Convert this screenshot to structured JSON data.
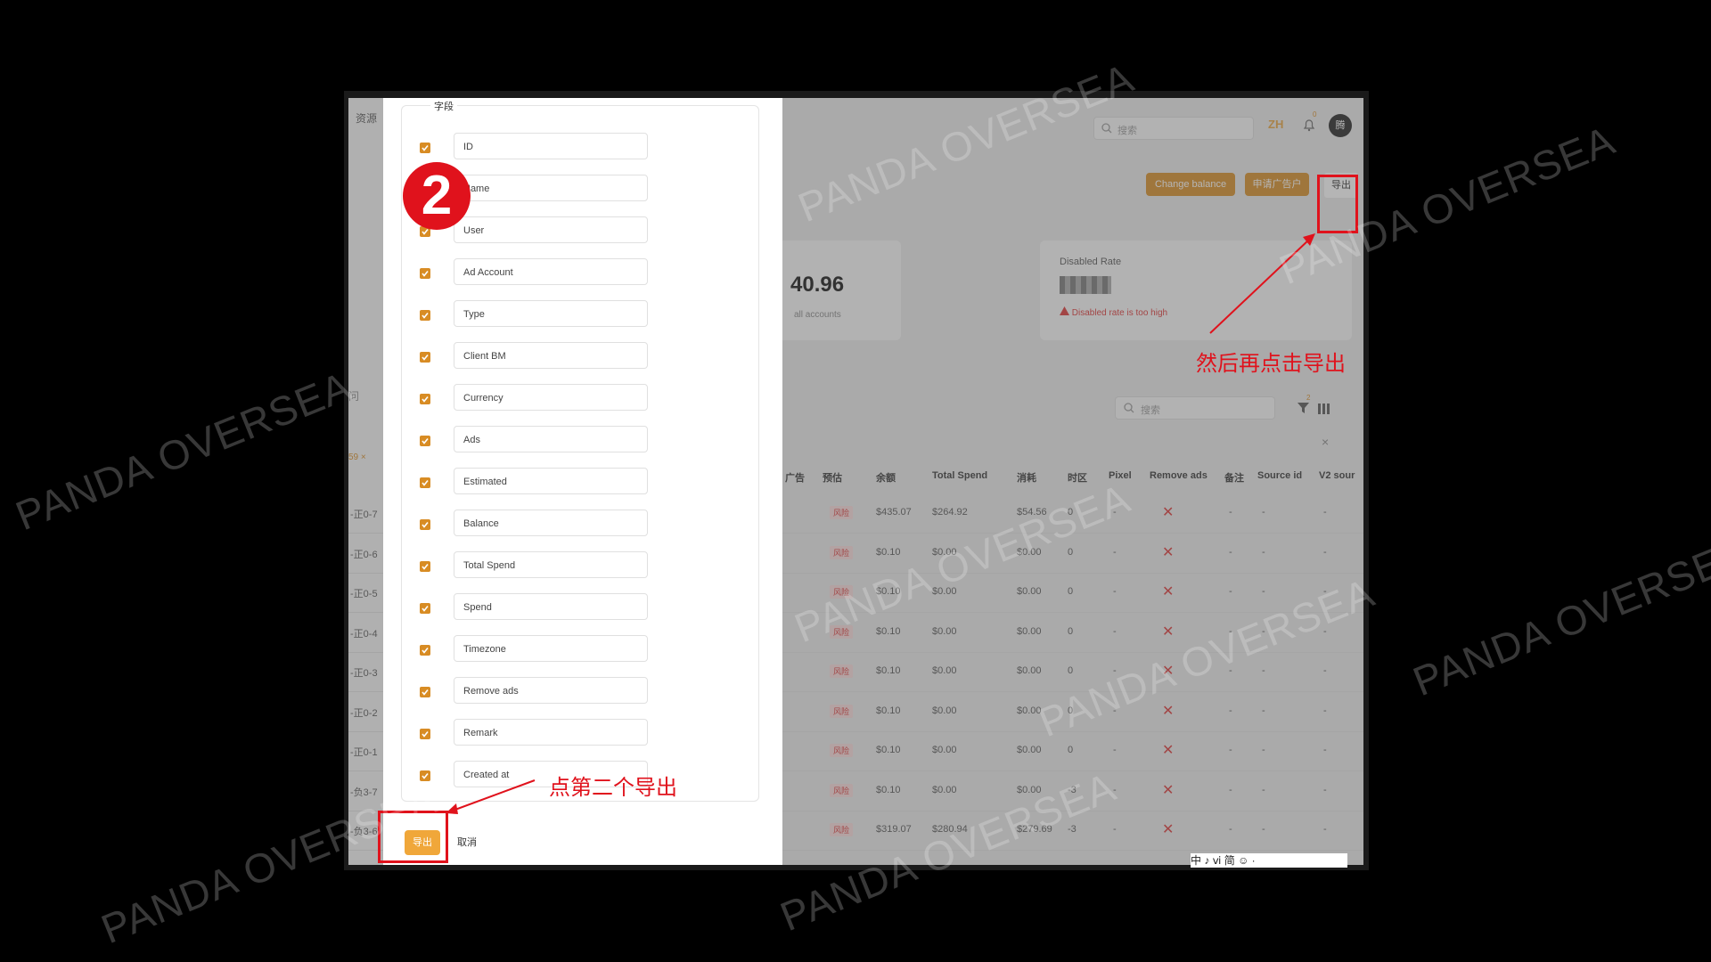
{
  "topbar": {
    "nav_left": "资源",
    "search_placeholder": "搜索",
    "lang": "ZH",
    "bell_count": "0",
    "avatar": "腾"
  },
  "actions": {
    "change_balance": "Change balance",
    "apply_account": "申请广告户",
    "export": "导出"
  },
  "stats": {
    "balance_value": "40.96",
    "balance_caption": "all accounts",
    "disabled_rate_title": "Disabled Rate",
    "disabled_rate_warning": "Disabled rate is too high"
  },
  "side_labels": [
    "问",
    "59 ×"
  ],
  "table": {
    "search_placeholder": "搜索",
    "filter_count": "2",
    "headers": [
      "广告",
      "预估",
      "余额",
      "Total Spend",
      "消耗",
      "时区",
      "Pixel",
      "Remove ads",
      "备注",
      "Source id",
      "V2 sour"
    ],
    "row_ids": [
      "-正0-7",
      "-正0-6",
      "-正0-5",
      "-正0-4",
      "-正0-3",
      "-正0-2",
      "-正0-1",
      "-负3-7",
      "-负3-6"
    ],
    "tag": "风险",
    "rows": [
      {
        "balance": "$435.07",
        "total": "$264.92",
        "spend": "$54.56",
        "tz": "0"
      },
      {
        "balance": "$0.10",
        "total": "$0.00",
        "spend": "$0.00",
        "tz": "0"
      },
      {
        "balance": "$0.10",
        "total": "$0.00",
        "spend": "$0.00",
        "tz": "0"
      },
      {
        "balance": "$0.10",
        "total": "$0.00",
        "spend": "$0.00",
        "tz": "0"
      },
      {
        "balance": "$0.10",
        "total": "$0.00",
        "spend": "$0.00",
        "tz": "0"
      },
      {
        "balance": "$0.10",
        "total": "$0.00",
        "spend": "$0.00",
        "tz": "0"
      },
      {
        "balance": "$0.10",
        "total": "$0.00",
        "spend": "$0.00",
        "tz": "0"
      },
      {
        "balance": "$0.10",
        "total": "$0.00",
        "spend": "$0.00",
        "tz": "-3"
      },
      {
        "balance": "$319.07",
        "total": "$280.94",
        "spend": "$279.69",
        "tz": "-3"
      }
    ],
    "dash": "-",
    "close": "×"
  },
  "panel": {
    "fields_title": "字段",
    "fields": [
      "ID",
      "Name",
      "User",
      "Ad Account",
      "Type",
      "Client BM",
      "Currency",
      "Ads",
      "Estimated",
      "Balance",
      "Total Spend",
      "Spend",
      "Timezone",
      "Remove ads",
      "Remark",
      "Created at"
    ],
    "export_label": "导出",
    "cancel_label": "取消"
  },
  "annotations": {
    "step_number": "2",
    "click_second_export": "点第二个导出",
    "then_click_export": "然后再点击导出"
  },
  "watermark": "PANDA OVERSEA",
  "ime_bar": "中 ♪ ⅵ 简 ☺ ·"
}
